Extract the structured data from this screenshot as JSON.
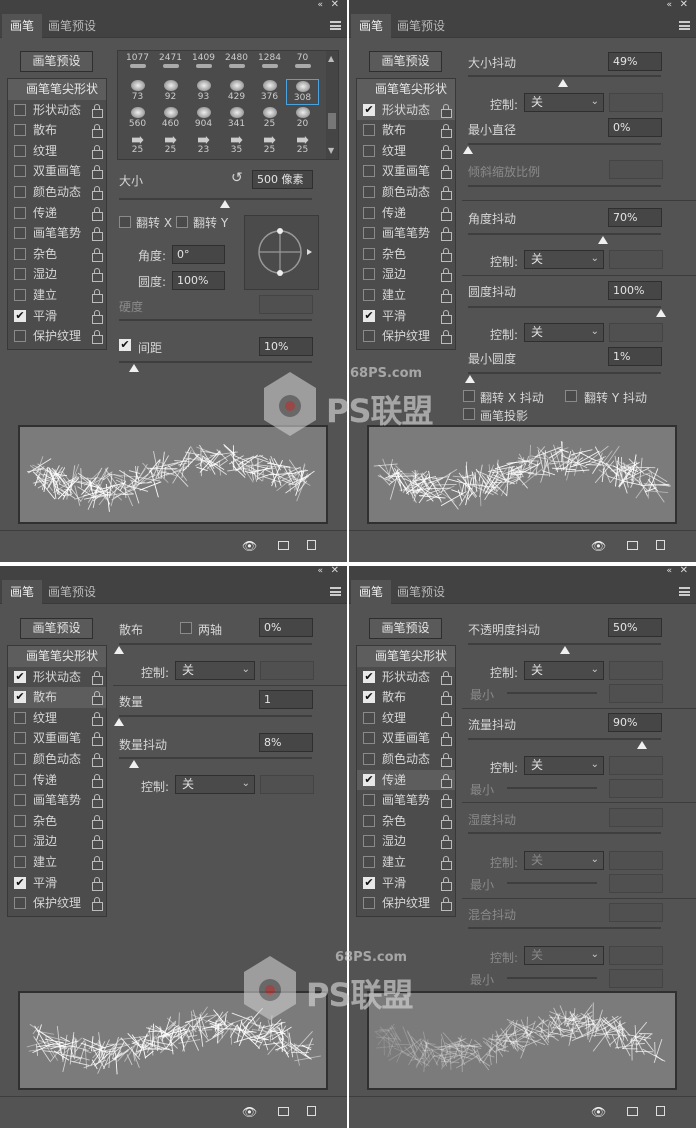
{
  "common": {
    "tab_brush": "画笔",
    "tab_presets": "画笔预设",
    "brush_presets_button": "画笔预设",
    "list_head": "画笔笔尖形状",
    "control_label": "控制:",
    "control_value": "关",
    "watermark_url": "68PS.com",
    "watermark_logo": "PS联盟"
  },
  "list_labels": [
    "形状动态",
    "散布",
    "纹理",
    "双重画笔",
    "颜色动态",
    "传递",
    "画笔笔势",
    "杂色",
    "湿边",
    "建立",
    "平滑",
    "保护纹理"
  ],
  "p1": {
    "checks": [
      false,
      false,
      false,
      false,
      false,
      false,
      false,
      false,
      false,
      false,
      true,
      false
    ],
    "grid_numbers": [
      "1077",
      "2471",
      "1409",
      "2480",
      "1284",
      "70",
      "73",
      "92",
      "93",
      "429",
      "376",
      "308",
      "560",
      "460",
      "904",
      "341",
      "25",
      "20",
      "25",
      "25",
      "23",
      "35",
      "25",
      "25"
    ],
    "size_label": "大小",
    "size_value": "500 像素",
    "flip_x": "翻转 X",
    "flip_y": "翻转 Y",
    "angle_label": "角度:",
    "angle_value": "0°",
    "roundness_label": "圆度:",
    "roundness_value": "100%",
    "hardness_label": "硬度",
    "spacing_label": "间距",
    "spacing_value": "10%",
    "spacing_checked": true
  },
  "p2": {
    "checks": [
      true,
      false,
      false,
      false,
      false,
      false,
      false,
      false,
      false,
      false,
      true,
      false
    ],
    "size_jitter_label": "大小抖动",
    "size_jitter_value": "49%",
    "min_diameter_label": "最小直径",
    "min_diameter_value": "0%",
    "tilt_scale_label": "倾斜缩放比例",
    "angle_jitter_label": "角度抖动",
    "angle_jitter_value": "70%",
    "roundness_jitter_label": "圆度抖动",
    "roundness_jitter_value": "100%",
    "min_roundness_label": "最小圆度",
    "min_roundness_value": "1%",
    "flip_x_jitter": "翻转 X 抖动",
    "flip_y_jitter": "翻转 Y 抖动",
    "brush_projection": "画笔投影"
  },
  "p3": {
    "checks": [
      true,
      true,
      false,
      false,
      false,
      false,
      false,
      false,
      false,
      false,
      true,
      false
    ],
    "scatter_label": "散布",
    "both_axes": "两轴",
    "scatter_value": "0%",
    "count_label": "数量",
    "count_value": "1",
    "count_jitter_label": "数量抖动",
    "count_jitter_value": "8%"
  },
  "p4": {
    "checks": [
      true,
      true,
      false,
      false,
      false,
      true,
      false,
      false,
      false,
      false,
      true,
      false
    ],
    "opacity_jitter_label": "不透明度抖动",
    "opacity_jitter_value": "50%",
    "min_label": "最小",
    "flow_jitter_label": "流量抖动",
    "flow_jitter_value": "90%",
    "wetness_jitter_label": "湿度抖动",
    "mix_jitter_label": "混合抖动"
  },
  "slider_levels": {
    "p1_size": 0.55,
    "p1_spacing": 0.04,
    "p2_size_jitter": 0.49,
    "p2_min_diameter": 0.0,
    "p2_angle_jitter": 0.7,
    "p2_roundness_jitter": 1.0,
    "p2_min_roundness": 0.01,
    "p3_scatter": 0.0,
    "p3_count": 0.0,
    "p3_count_jitter": 0.08,
    "p4_opacity_jitter": 0.5,
    "p4_flow_jitter": 0.9
  },
  "icons": [
    "double-chevron-icon",
    "close-icon",
    "panel-menu-icon",
    "lock-icon",
    "checkbox-icon",
    "reset-icon",
    "dropdown-arrow-icon",
    "eye-brush-icon",
    "new-brush-icon",
    "create-new-icon"
  ]
}
